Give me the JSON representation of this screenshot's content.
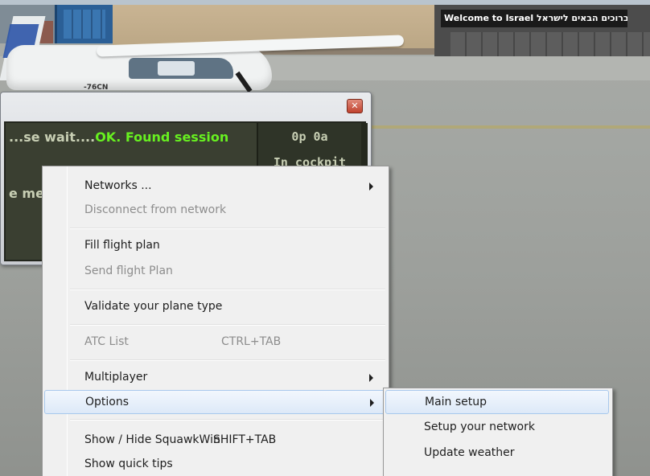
{
  "scene": {
    "billboard_text": "Welcome to Israel ברוכים הבאים לישראל",
    "aircraft_registration": "-76CN"
  },
  "squawkbox": {
    "status_wait": "...se wait....",
    "status_ok": "OK. Found session",
    "message_fragment": "e me",
    "counts": "0p 0a",
    "location": "In cockpit",
    "close_glyph": "✕"
  },
  "context_menu": {
    "items": [
      {
        "label": "Networks ...",
        "enabled": true,
        "submenu": true
      },
      {
        "label": "Disconnect from network",
        "enabled": false
      },
      {
        "label": "Fill flight plan",
        "enabled": true
      },
      {
        "label": "Send flight Plan",
        "enabled": false
      },
      {
        "label": "Validate your plane type",
        "enabled": true
      },
      {
        "label": "ATC List",
        "shortcut": "CTRL+TAB",
        "enabled": false
      },
      {
        "label": "Multiplayer",
        "enabled": true,
        "submenu": true
      },
      {
        "label": "Options",
        "enabled": true,
        "submenu": true,
        "highlighted": true
      },
      {
        "label": "Show / Hide SquawkWin",
        "shortcut": "SHIFT+TAB",
        "enabled": true
      },
      {
        "label": "Show quick tips",
        "enabled": true
      }
    ]
  },
  "options_submenu": {
    "items": [
      {
        "label": "Main setup",
        "highlighted": true
      },
      {
        "label": "Setup your network"
      },
      {
        "label": "Update weather"
      }
    ]
  },
  "colors": {
    "menu_background": "#f0f0f0",
    "highlight": "#dde9f8",
    "status_ok": "#67f020",
    "disabled_text": "#8d8d8d"
  }
}
